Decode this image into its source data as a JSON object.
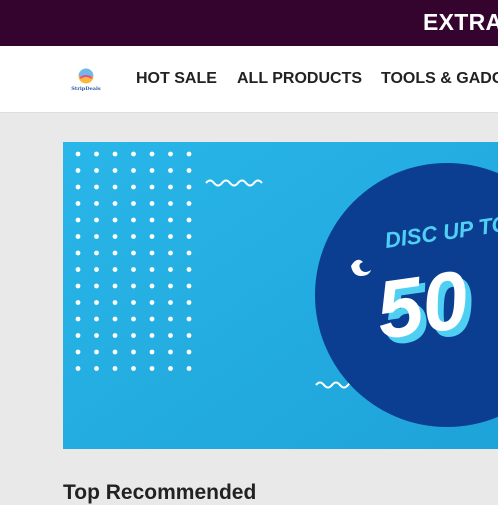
{
  "promo": {
    "text": "EXTRA"
  },
  "brand": {
    "logo_text": "StripDeals"
  },
  "nav": {
    "items": [
      {
        "label": "HOT SALE"
      },
      {
        "label": "ALL PRODUCTS"
      },
      {
        "label": "TOOLS & GADG"
      }
    ]
  },
  "banner": {
    "headline": "DISC UP TO",
    "value": "50"
  },
  "sections": {
    "top_recommended": "Top Recommended"
  },
  "colors": {
    "promo_bg": "#35042e",
    "banner_bg": "#24aee2",
    "circle": "#0b3d91",
    "headline": "#4fd0f2"
  }
}
